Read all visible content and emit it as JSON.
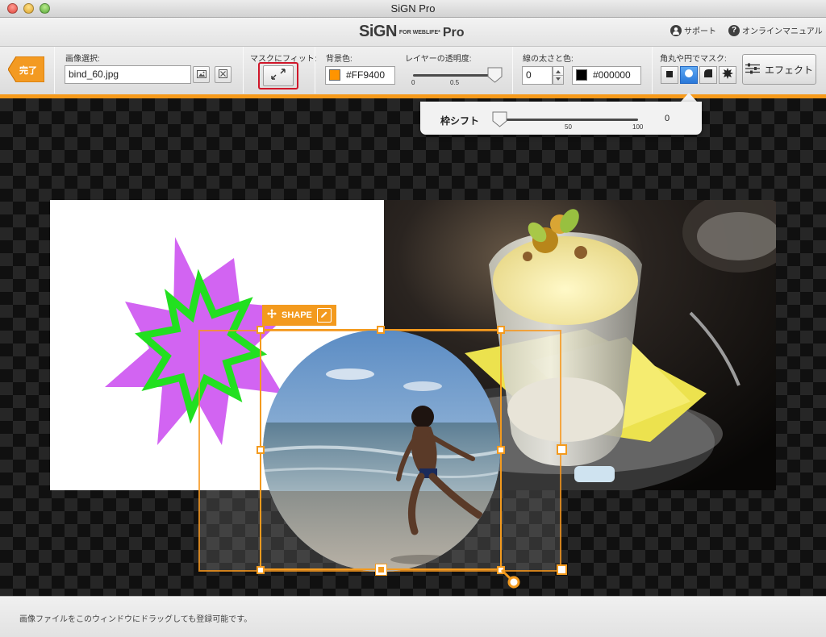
{
  "window": {
    "title": "SiGN Pro"
  },
  "header": {
    "logo_main": "SiGN",
    "logo_small": "FOR WEBLIFE*",
    "logo_pro": "Pro",
    "support_label": "サポート",
    "manual_label": "オンラインマニュアル"
  },
  "toolbar": {
    "done_label": "完了",
    "image_select_label": "画像選択:",
    "image_file": "bind_60.jpg",
    "mask_fit_label": "マスクにフィット:",
    "bg_color_label": "背景色:",
    "bg_color_value": "#FF9400",
    "opacity_label": "レイヤーの透明度:",
    "opacity_min": "0",
    "opacity_mid": "0.5",
    "opacity_value": 1.0,
    "stroke_label": "線の太さと色:",
    "stroke_width": "0",
    "stroke_color_value": "#000000",
    "mask_shape_label": "角丸や円でマスク:",
    "mask_shapes": [
      "rectangle-icon",
      "circle-icon",
      "rounded-corner-icon",
      "starburst-icon"
    ],
    "mask_shape_selected": "circle",
    "effect_label": "エフェクト"
  },
  "popover": {
    "frame_shift_label": "枠シフト",
    "tick_mid": "50",
    "tick_max": "100",
    "value": "0"
  },
  "canvas": {
    "shape_label": "SHAPE"
  },
  "status": {
    "hint": "画像ファイルをこのウィンドウにドラッグしても登録可能です。"
  },
  "colors": {
    "accent": "#F79A1A",
    "bg_color": "#FF9400",
    "stroke_color": "#000000",
    "selected_shape": "#2A78D9",
    "starburst_outer": "#D060F0",
    "starburst_inner": "#22E020"
  }
}
